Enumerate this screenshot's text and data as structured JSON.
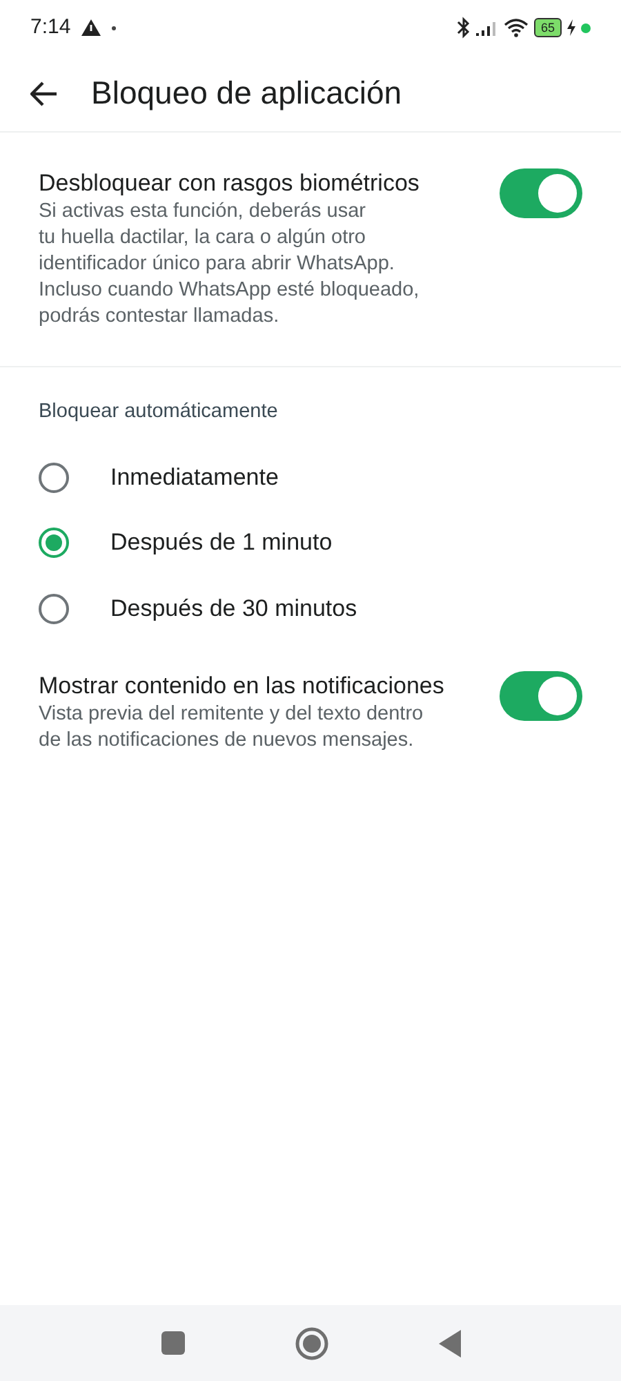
{
  "status_bar": {
    "time": "7:14",
    "battery": "65"
  },
  "header": {
    "title": "Bloqueo de aplicación"
  },
  "biometric": {
    "title": "Desbloquear con rasgos biométricos",
    "lines": [
      "Si activas esta función, deberás usar",
      "tu huella dactilar, la cara o algún otro",
      "identificador único para abrir WhatsApp.",
      "Incluso cuando WhatsApp esté bloqueado,",
      "podrás contestar llamadas."
    ],
    "on": true
  },
  "auto_lock": {
    "heading": "Bloquear automáticamente",
    "options": [
      {
        "label": "Inmediatamente",
        "selected": false
      },
      {
        "label": "Después de 1 minuto",
        "selected": true
      },
      {
        "label": "Después de 30 minutos",
        "selected": false
      }
    ]
  },
  "notifications": {
    "title": "Mostrar contenido en las notificaciones",
    "lines": [
      "Vista previa del remitente y del texto dentro",
      "de las notificaciones de nuevos mensajes."
    ],
    "on": true
  }
}
